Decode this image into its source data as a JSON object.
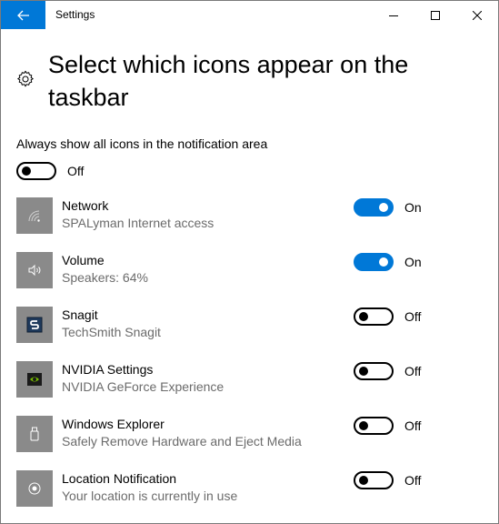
{
  "window": {
    "title": "Settings"
  },
  "header": {
    "title": "Select which icons appear on the taskbar"
  },
  "always_show": {
    "label": "Always show all icons in the notification area",
    "state": "Off",
    "enabled": false
  },
  "items": [
    {
      "name": "Network",
      "description": "SPALyman Internet access",
      "state": "On",
      "enabled": true,
      "icon": "network-wifi-icon"
    },
    {
      "name": "Volume",
      "description": "Speakers: 64%",
      "state": "On",
      "enabled": true,
      "icon": "speaker-icon"
    },
    {
      "name": "Snagit",
      "description": "TechSmith Snagit",
      "state": "Off",
      "enabled": false,
      "icon": "snagit-icon"
    },
    {
      "name": "NVIDIA Settings",
      "description": "NVIDIA GeForce Experience",
      "state": "Off",
      "enabled": false,
      "icon": "nvidia-icon"
    },
    {
      "name": "Windows Explorer",
      "description": "Safely Remove Hardware and Eject Media",
      "state": "Off",
      "enabled": false,
      "icon": "usb-drive-icon"
    },
    {
      "name": "Location Notification",
      "description": "Your location is currently in use",
      "state": "Off",
      "enabled": false,
      "icon": "location-icon"
    }
  ],
  "colors": {
    "accent": "#0078d7",
    "icon_tile": "#8a8a8a",
    "secondary_text": "#6b6b6b"
  }
}
